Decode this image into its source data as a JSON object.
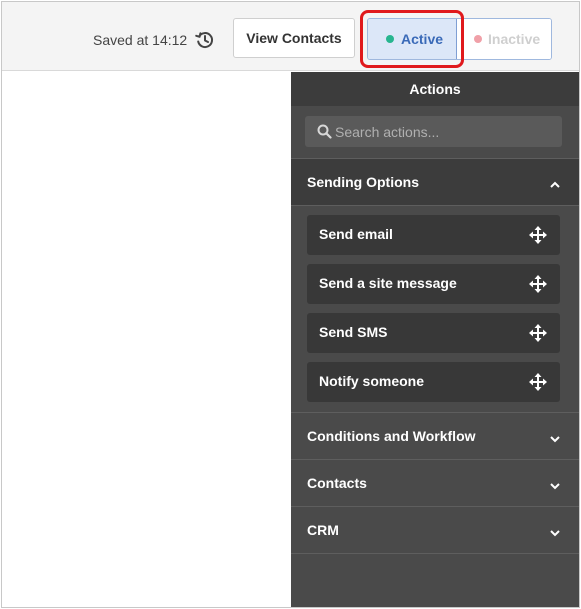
{
  "topbar": {
    "saved_text": "Saved at 14:12",
    "history_icon": "history-icon",
    "view_contacts_label": "View Contacts",
    "status": {
      "active_label": "Active",
      "inactive_label": "Inactive",
      "selected": "Active",
      "active_color": "#27b58f",
      "inactive_color": "#f0a0a8"
    },
    "highlight_color": "#e0191c"
  },
  "panel": {
    "title": "Actions",
    "search": {
      "placeholder": "Search actions...",
      "value": ""
    },
    "sections": [
      {
        "title": "Sending Options",
        "expanded": true,
        "items": [
          {
            "label": "Send email",
            "icon": "move-icon"
          },
          {
            "label": "Send a site message",
            "icon": "move-icon"
          },
          {
            "label": "Send SMS",
            "icon": "move-icon"
          },
          {
            "label": "Notify someone",
            "icon": "move-icon"
          }
        ]
      },
      {
        "title": "Conditions and Workflow",
        "expanded": false
      },
      {
        "title": "Contacts",
        "expanded": false
      },
      {
        "title": "CRM",
        "expanded": false
      }
    ]
  }
}
